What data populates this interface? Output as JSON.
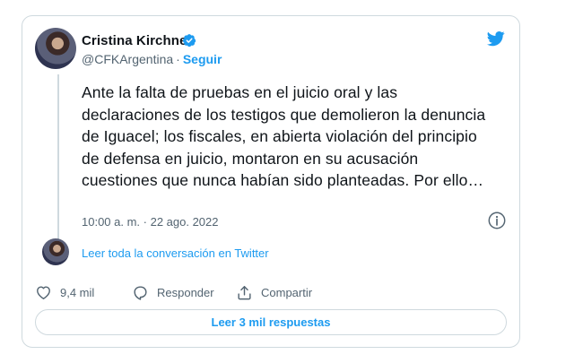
{
  "author": {
    "name": "Cristina Kirchner",
    "handle": "@CFKArgentina",
    "separator": "·",
    "follow_label": "Seguir"
  },
  "tweet": {
    "text": "Ante la falta de pruebas en el juicio oral y las declaraciones de los testigos que demolieron la denuncia de Iguacel; los fiscales, en abierta violación del principio de defensa en juicio, montaron en su acusación cuestiones que nunca habían sido planteadas. Por ello…",
    "timestamp": "10:00 a. m. · 22 ago. 2022"
  },
  "conversation_link": "Leer toda la conversación en Twitter",
  "actions": {
    "likes": "9,4 mil",
    "reply_label": "Responder",
    "share_label": "Compartir"
  },
  "read_replies_label": "Leer 3 mil respuestas",
  "icons": [
    "verified-badge-icon",
    "twitter-bird-icon",
    "info-icon",
    "heart-icon",
    "reply-icon",
    "share-icon"
  ],
  "colors": {
    "accent": "#1d9bf0",
    "text": "#0f1419",
    "secondary_text": "#536471",
    "border": "#cfd9de"
  }
}
